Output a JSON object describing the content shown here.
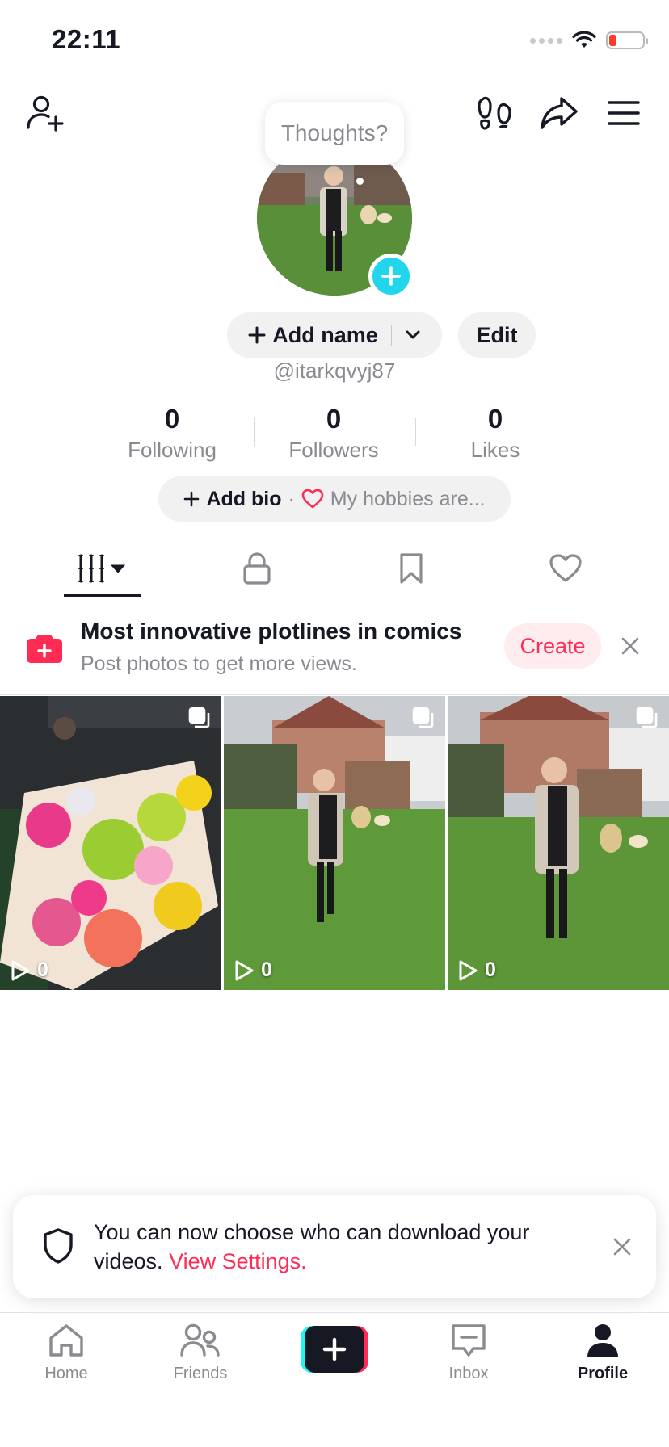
{
  "status_bar": {
    "time": "22:11"
  },
  "header": {
    "add_user_icon": "person-plus-icon",
    "footprints_icon": "footprints-icon",
    "share_icon": "share-arrow-icon",
    "menu_icon": "hamburger-icon"
  },
  "profile": {
    "thought_bubble": "Thoughts?",
    "add_name_label": "Add name",
    "edit_label": "Edit",
    "username": "@itarkqvyj87",
    "stats": [
      {
        "value": "0",
        "label": "Following"
      },
      {
        "value": "0",
        "label": "Followers"
      },
      {
        "value": "0",
        "label": "Likes"
      }
    ],
    "bio": {
      "add_bio_label": "Add bio",
      "separator": "·",
      "placeholder": "My hobbies are..."
    }
  },
  "tabs": [
    {
      "icon": "grid-icon",
      "active": true
    },
    {
      "icon": "lock-icon",
      "active": false
    },
    {
      "icon": "bookmark-icon",
      "active": false
    },
    {
      "icon": "heart-icon",
      "active": false
    }
  ],
  "promo": {
    "title": "Most innovative plotlines in comics",
    "subtitle": "Post photos to get more views.",
    "create_label": "Create"
  },
  "posts": [
    {
      "views": "0",
      "subject": "flower bouquet"
    },
    {
      "views": "0",
      "subject": "woman in garden"
    },
    {
      "views": "0",
      "subject": "woman in garden"
    }
  ],
  "toast": {
    "text": "You can now choose who can download your videos.",
    "link": "View Settings."
  },
  "nav": {
    "home": "Home",
    "friends": "Friends",
    "inbox": "Inbox",
    "profile": "Profile"
  },
  "colors": {
    "accent": "#fe2c55",
    "cyan": "#20d5ec",
    "text": "#161823",
    "secondary": "#8a8b91"
  }
}
